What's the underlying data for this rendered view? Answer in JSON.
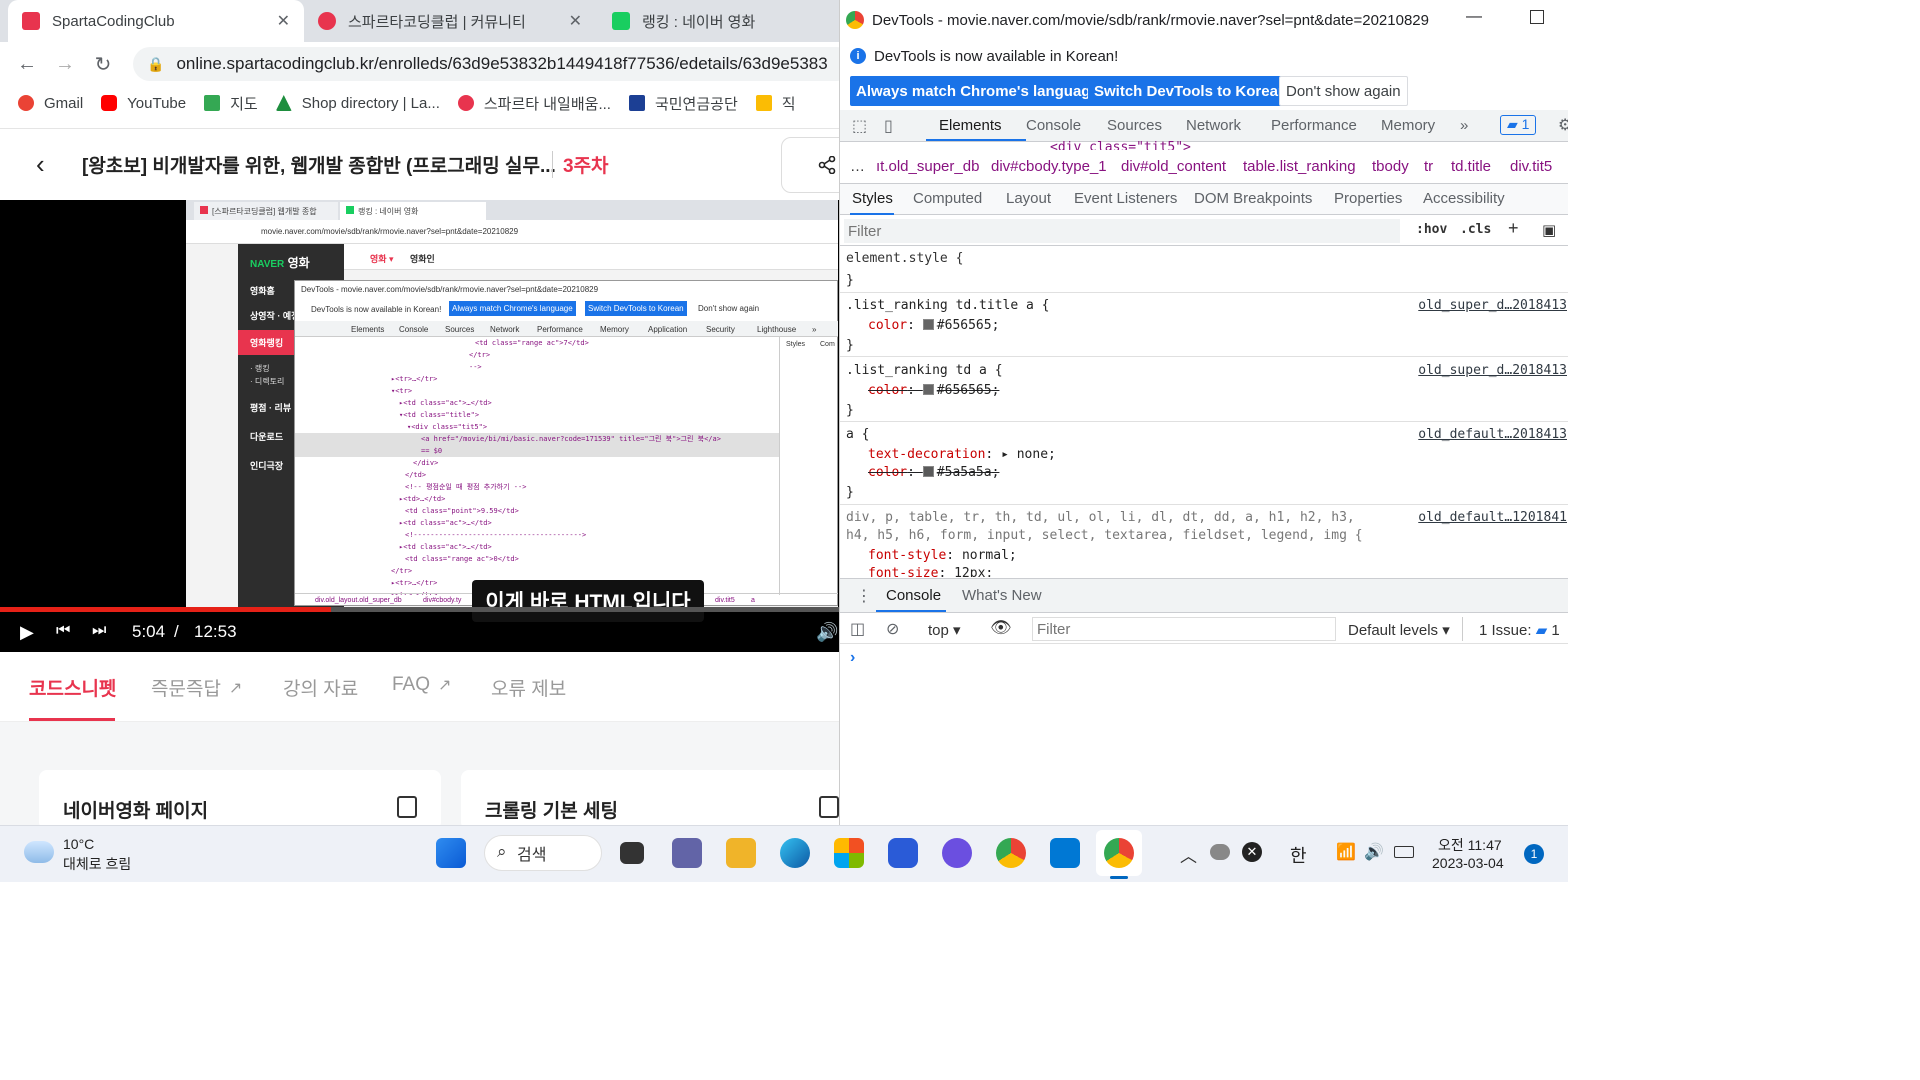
{
  "browser": {
    "tabs": [
      {
        "label": "SpartaCodingClub",
        "active": true,
        "favicon_color": "#e8344e"
      },
      {
        "label": "스파르타코딩클럽 | 커뮤니티",
        "active": false,
        "favicon_color": "#e8344e"
      },
      {
        "label": "랭킹 : 네이버 영화",
        "active": false,
        "favicon_color": "#19ce60"
      }
    ],
    "url": "online.spartacodingclub.kr/enrolleds/63d9e53832b1449418f77536/edetails/63d9e5383",
    "bookmarks": [
      {
        "label": "Gmail",
        "color": "#ea4335"
      },
      {
        "label": "YouTube",
        "color": "#ff0000"
      },
      {
        "label": "지도",
        "color": "#34a853"
      },
      {
        "label": "Shop directory | La...",
        "color": "#1e8e3e"
      },
      {
        "label": "스파르타 내일배움...",
        "color": "#e8344e"
      },
      {
        "label": "국민연금공단",
        "color": "#1c3f94"
      },
      {
        "label": "직",
        "color": "#fbbc04"
      }
    ]
  },
  "page": {
    "course_title": "[왕초보] 비개발자를 위한, 웹개발 종합반 (프로그래밍 실무...",
    "week": "3주차",
    "video": {
      "current_time": "5:04",
      "separator": "/",
      "duration": "12:53",
      "progress": 0.394,
      "subtitle": "이게 바로 HTML입니다"
    },
    "tabs": [
      {
        "label": "코드스니펫",
        "active": true,
        "external": false
      },
      {
        "label": "즉문즉답",
        "active": false,
        "external": true
      },
      {
        "label": "강의 자료",
        "active": false,
        "external": false
      },
      {
        "label": "FAQ",
        "active": false,
        "external": true
      },
      {
        "label": "오류 제보",
        "active": false,
        "external": false
      }
    ],
    "cards": [
      {
        "title": "네이버영화 페이지"
      },
      {
        "title": "크롤링 기본 세팅"
      }
    ]
  },
  "inner_screenshot": {
    "tabs": [
      "[스파르타코딩클럽] 웹개발 종합",
      "랭킹 : 네이버 영화"
    ],
    "url": "movie.naver.com/movie/sdb/rank/rmovie.naver?sel=pnt&date=20210829",
    "naver_logo": "NAVER",
    "naver_title": "영화",
    "naver_top_nav": [
      "영화 ▾",
      "영화인"
    ],
    "naver_menu": [
      "영화홈",
      "상영작 · 예정",
      "영화랭킹",
      "· 랭킹",
      "· 디렉토리",
      "평점 · 리뷰",
      "다운로드",
      "인디극장"
    ],
    "devtools_title": "DevTools - movie.naver.com/movie/sdb/rank/rmovie.naver?sel=pnt&date=20210829",
    "infobar_text": "DevTools is now available in Korean!",
    "btn1": "Always match Chrome's language",
    "btn2": "Switch DevTools to Korean",
    "btn3": "Don't show again",
    "devtabs": [
      "Elements",
      "Console",
      "Sources",
      "Network",
      "Performance",
      "Memory",
      "Application",
      "Security",
      "Lighthouse",
      "»"
    ],
    "code_lines": [
      "<td class=\"range ac\">7</td>",
      "</tr>",
      "-->",
      "▸<tr>…</tr>",
      "▾<tr>",
      "▸<td class=\"ac\">…</td>",
      "▾<td class=\"title\">",
      "▾<div class=\"tit5\">",
      "<a href=\"/movie/bi/mi/basic.naver?code=171539\" title=\"그린 북\">그린 북</a>",
      "== $0",
      "</div>",
      "</td>",
      "<!-- 평점순일 때 평점 추가하기 -->",
      "▸<td>…</td>",
      "<td class=\"point\">9.59</td>",
      "▸<td class=\"ac\">…</td>",
      "<!---------------------------------------->",
      "▸<td class=\"ac\">…</td>",
      "<td class=\"range ac\">0</td>",
      "</tr>",
      "▸<tr>…</tr>",
      "▸<tr>…</tr>"
    ],
    "styles_tabs": [
      "Styles",
      "Com"
    ],
    "crumbs": [
      "div.old_layout.old_super_db",
      "div#cbody.ty",
      "div.tit5",
      "a"
    ]
  },
  "devtools": {
    "title": "DevTools - movie.naver.com/movie/sdb/rank/rmovie.naver?sel=pnt&date=20210829",
    "infobar_text": "DevTools is now available in Korean!",
    "btn_match": "Always match Chrome's language",
    "btn_switch": "Switch DevTools to Korean",
    "btn_dont": "Don't show again",
    "tabs": [
      "Elements",
      "Console",
      "Sources",
      "Network",
      "Performance",
      "Memory",
      "»"
    ],
    "issues_count": "1",
    "partial_code": "<div class=\"tit5\">",
    "crumbs": [
      "…",
      "ıt.old_super_db",
      "div#cbody.type_1",
      "div#old_content",
      "table.list_ranking",
      "tbody",
      "tr",
      "td.title",
      "div.tit5"
    ],
    "styles_tabs": [
      "Styles",
      "Computed",
      "Layout",
      "Event Listeners",
      "DOM Breakpoints",
      "Properties",
      "Accessibility"
    ],
    "filter_placeholder": "Filter",
    "hov": ":hov",
    "cls": ".cls",
    "rules": [
      {
        "selector": "element.style {",
        "source": "",
        "props": []
      },
      {
        "selector": ".list_ranking td.title a {",
        "source": "old_super_d…2018413",
        "props": [
          {
            "name": "color",
            "value": "#656565",
            "swatch": "#656565",
            "struck": false
          }
        ]
      },
      {
        "selector": ".list_ranking td a {",
        "source": "old_super_d…2018413",
        "props": [
          {
            "name": "color",
            "value": "#656565",
            "swatch": "#656565",
            "struck": true
          }
        ]
      },
      {
        "selector": "a {",
        "source": "old_default…2018413",
        "props": [
          {
            "name": "text-decoration",
            "value": "▸ none",
            "swatch": "",
            "struck": false
          },
          {
            "name": "color",
            "value": "#5a5a5a",
            "swatch": "#5a5a5a",
            "struck": true
          }
        ]
      },
      {
        "selector": "div, p, table, tr, th, td, ul, ol, li, dl, dt, dd, a, h1, h2, h3,",
        "selector2": "h4, h5, h6, form, input, select, textarea, fieldset, legend, img {",
        "source": "old_default…1201841",
        "props": [
          {
            "name": "font-style",
            "value": "normal",
            "swatch": "",
            "struck": false
          },
          {
            "name": "font-size",
            "value": "12px",
            "swatch": "",
            "struck": false
          }
        ]
      }
    ],
    "drawer_tabs": [
      "Console",
      "What's New"
    ],
    "context": "top",
    "console_filter": "Filter",
    "levels": "Default levels",
    "issues_label": "1 Issue:",
    "issues_badge": "1",
    "prompt": "›"
  },
  "taskbar": {
    "weather_temp": "10°C",
    "weather_desc": "대체로 흐림",
    "search_label": "검색",
    "ime": "한",
    "time": "오전 11:47",
    "date": "2023-03-04",
    "notification_count": "1"
  }
}
